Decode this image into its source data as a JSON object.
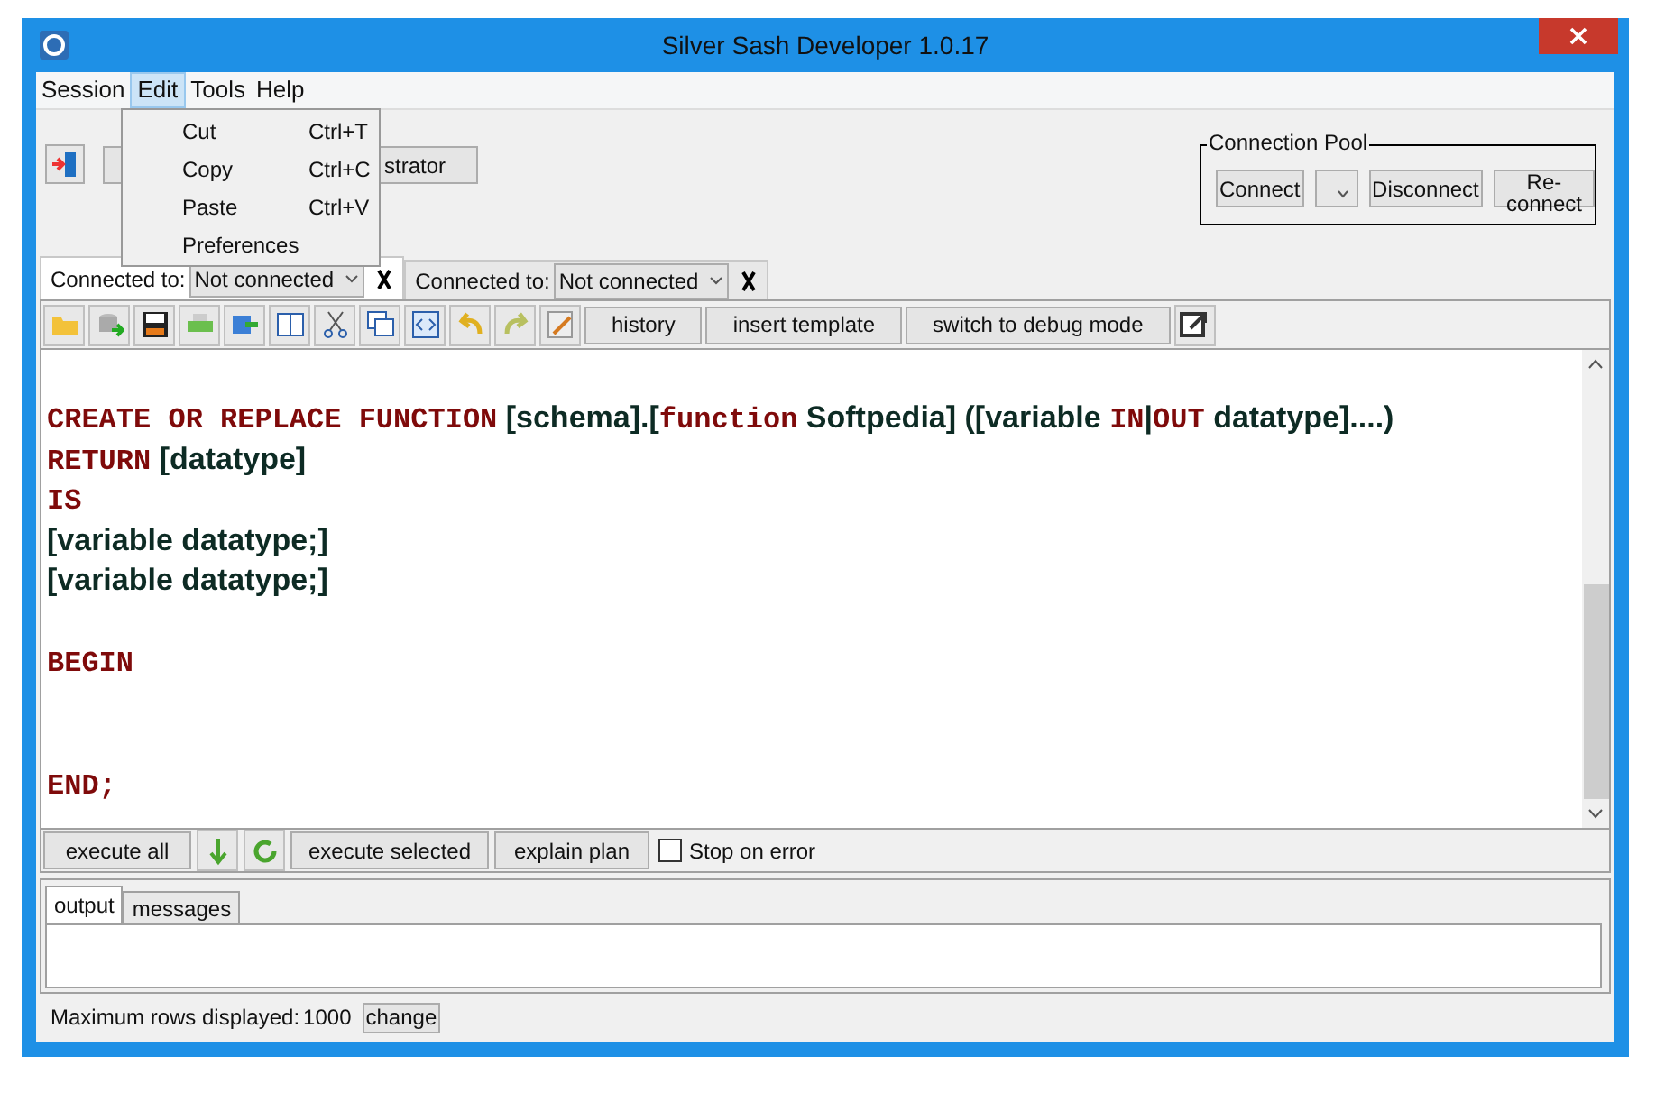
{
  "window": {
    "title": "Silver Sash Developer 1.0.17"
  },
  "menu": [
    {
      "label": "Session",
      "selected": false
    },
    {
      "label": "Edit",
      "selected": true
    },
    {
      "label": "Tools",
      "selected": false
    },
    {
      "label": "Help",
      "selected": false
    }
  ],
  "edit_menu": [
    {
      "label": "Cut",
      "shortcut": "Ctrl+T"
    },
    {
      "label": "Copy",
      "shortcut": "Ctrl+C"
    },
    {
      "label": "Paste",
      "shortcut": "Ctrl+V"
    },
    {
      "label": "Preferences"
    }
  ],
  "toolbar": {
    "partial_button": "strator"
  },
  "connection_pool": {
    "title": "Connection Pool",
    "buttons": [
      "Connect",
      "Disconnect",
      "Re-connect"
    ]
  },
  "connection_tabs": [
    {
      "label": "Connected to:",
      "value": "Not connected",
      "selected": true
    },
    {
      "label": "Connected to:",
      "value": "Not connected",
      "selected": false
    }
  ],
  "editor_toolbar": {
    "buttons": [
      "history",
      "insert template",
      "switch to debug mode"
    ]
  },
  "editor_lines": [
    {
      "kind": "code",
      "segments": [
        {
          "kind": "keyword",
          "text": "CREATE OR REPLACE FUNCTION"
        },
        {
          "kind": "text",
          "text": " [schema].["
        },
        {
          "kind": "keyword",
          "text": "function"
        },
        {
          "kind": "text",
          "text": " Softpedia] ([variable "
        },
        {
          "kind": "keyword",
          "text": "IN"
        },
        {
          "kind": "text",
          "text": "|"
        },
        {
          "kind": "keyword",
          "text": "OUT"
        },
        {
          "kind": "text",
          "text": " datatype]....)"
        }
      ]
    },
    {
      "kind": "code",
      "segments": [
        {
          "kind": "keyword",
          "text": "RETURN"
        },
        {
          "kind": "text",
          "text": " [datatype]"
        }
      ]
    },
    {
      "kind": "code",
      "segments": [
        {
          "kind": "keyword",
          "text": "IS"
        }
      ]
    },
    {
      "kind": "code",
      "segments": [
        {
          "kind": "text",
          "text": "[variable datatype;]"
        }
      ]
    },
    {
      "kind": "code",
      "segments": [
        {
          "kind": "text",
          "text": "[variable datatype;]"
        }
      ]
    },
    {
      "kind": "blank"
    },
    {
      "kind": "code",
      "segments": [
        {
          "kind": "keyword",
          "text": "BEGIN"
        }
      ]
    },
    {
      "kind": "blank"
    },
    {
      "kind": "blank"
    },
    {
      "kind": "code",
      "segments": [
        {
          "kind": "keyword",
          "text": "END;"
        }
      ]
    }
  ],
  "run_bar": {
    "execute_all": "execute all",
    "execute_selected": "execute selected",
    "explain_plan": "explain plan",
    "stop_on_error": {
      "label": "Stop on error",
      "checked": false
    }
  },
  "output_tabs": [
    {
      "label": "output",
      "selected": true
    },
    {
      "label": "messages",
      "selected": false
    }
  ],
  "status_bar": {
    "label": "Maximum rows displayed:",
    "value": "1000",
    "button": "change"
  }
}
